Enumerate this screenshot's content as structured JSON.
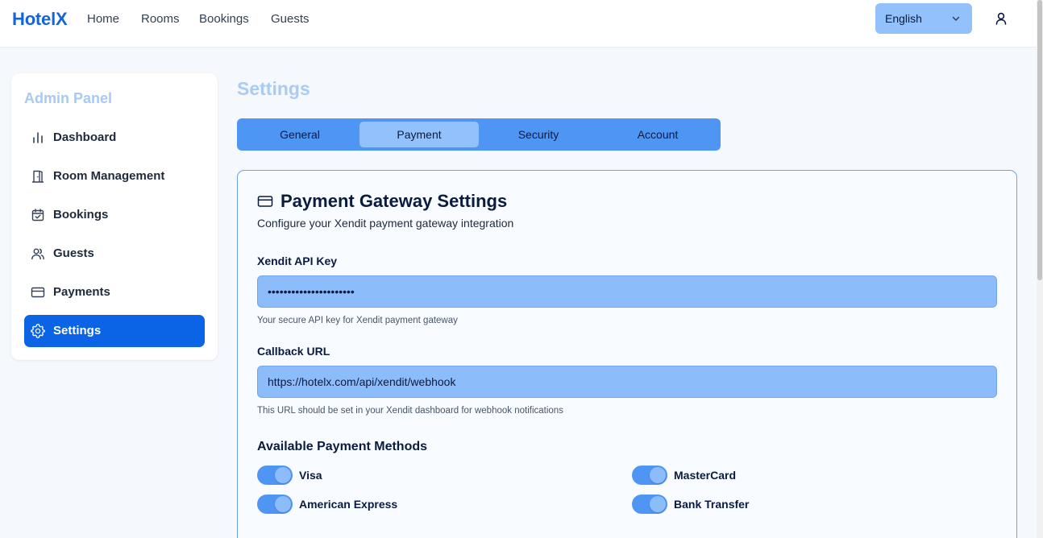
{
  "topbar": {
    "brand": "HotelX",
    "nav": [
      "Home",
      "Rooms",
      "Bookings",
      "Guests"
    ],
    "language": "English"
  },
  "sidebar": {
    "title": "Admin Panel",
    "items": [
      {
        "label": "Dashboard",
        "icon": "bar-chart-icon"
      },
      {
        "label": "Room Management",
        "icon": "door-icon"
      },
      {
        "label": "Bookings",
        "icon": "calendar-check-icon"
      },
      {
        "label": "Guests",
        "icon": "users-icon"
      },
      {
        "label": "Payments",
        "icon": "credit-card-icon"
      },
      {
        "label": "Settings",
        "icon": "gear-icon",
        "active": true
      }
    ]
  },
  "main": {
    "title": "Settings",
    "tabs": [
      "General",
      "Payment",
      "Security",
      "Account"
    ],
    "active_tab": "Payment"
  },
  "payment_card": {
    "title": "Payment Gateway Settings",
    "subtitle": "Configure your Xendit payment gateway integration",
    "api_key": {
      "label": "Xendit API Key",
      "value": "••••••••••••••••••••••",
      "hint": "Your secure API key for Xendit payment gateway"
    },
    "callback": {
      "label": "Callback URL",
      "value": "https://hotelx.com/api/xendit/webhook",
      "hint": "This URL should be set in your Xendit dashboard for webhook notifications"
    },
    "methods_title": "Available Payment Methods",
    "methods": [
      {
        "label": "Visa",
        "enabled": true
      },
      {
        "label": "MasterCard",
        "enabled": true
      },
      {
        "label": "American Express",
        "enabled": true
      },
      {
        "label": "Bank Transfer",
        "enabled": true
      }
    ]
  },
  "colors": {
    "brand": "#1565d8",
    "active_nav": "#0b63e5",
    "tabs_bg": "#4f96f4",
    "input_bg": "#8dbcfb"
  }
}
